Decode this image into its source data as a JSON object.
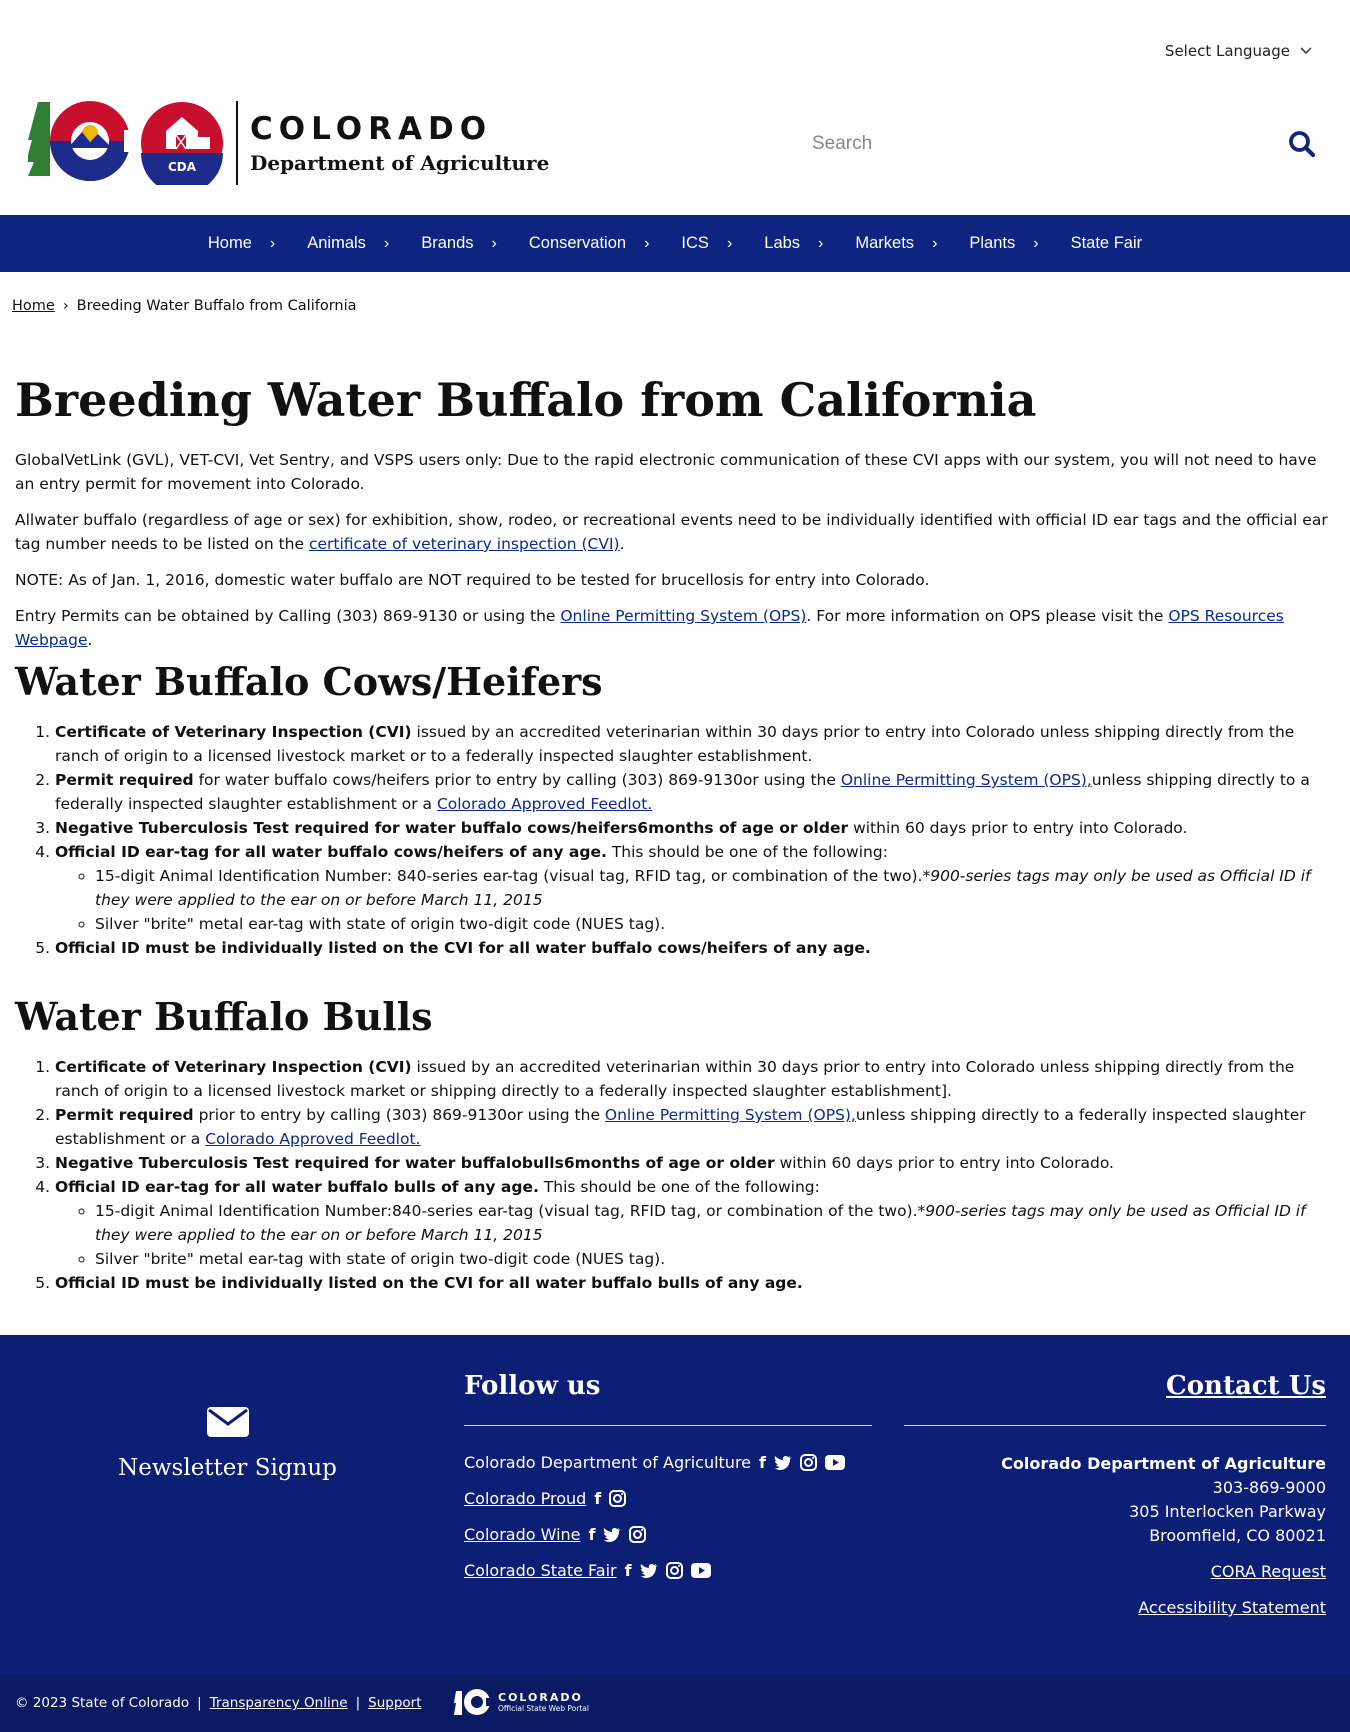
{
  "header": {
    "language_label": "Select Language",
    "logo_title": "COLORADO",
    "logo_subtitle": "Department of Agriculture",
    "logo_badge": "CDA",
    "search_placeholder": "Search"
  },
  "nav": {
    "items": [
      {
        "label": "Home"
      },
      {
        "label": "Animals"
      },
      {
        "label": "Brands"
      },
      {
        "label": "Conservation"
      },
      {
        "label": "ICS"
      },
      {
        "label": "Labs"
      },
      {
        "label": "Markets"
      },
      {
        "label": "Plants"
      },
      {
        "label": "State Fair"
      }
    ]
  },
  "breadcrumb": {
    "home": "Home",
    "separator": "›",
    "current": "Breeding Water Buffalo from California"
  },
  "page": {
    "title": "Breeding Water Buffalo from California",
    "p1": "GlobalVetLink (GVL), VET-CVI, Vet Sentry, and VSPS users only: Due to the rapid electronic communication of these CVI apps with our system, you will not need to have an entry permit for movement into Colorado.",
    "p2_text": "Allwater buffalo (regardless of age or sex) for exhibition, show, rodeo, or recreational events need to be individually identified with official ID ear tags and the official ear tag number needs to be listed on the ",
    "p2_link": "certificate of veterinary inspection (CVI)",
    "p2_end": ".",
    "p3": "NOTE: As of Jan. 1, 2016, domestic water buffalo are NOT required to be tested for brucellosis for entry into Colorado.",
    "p4_text": "Entry Permits can be obtained by Calling (303) 869-9130 or using the ",
    "p4_link1": "Online Permitting System (OPS)",
    "p4_mid": ". For more information on OPS please visit the ",
    "p4_link2": "OPS Resources Webpage",
    "p4_end": "."
  },
  "section_cows": {
    "heading": "Water Buffalo Cows/Heifers",
    "i1_bold": "Certificate of Veterinary Inspection (CVI)",
    "i1_text": " issued by an accredited veterinarian within 30 days prior to entry into Colorado unless shipping directly from the ranch of origin to a licensed livestock market or to a federally inspected slaughter establishment.",
    "i2_bold": "Permit required",
    "i2_text": " for water buffalo cows/heifers prior to entry by calling (303) 869-9130or using the ",
    "i2_link": "Online Permitting System (OPS),",
    "i2_text2": "unless shipping directly to a federally inspected slaughter establishment or a ",
    "i2_link2": "Colorado Approved Feedlot.",
    "i3_bold": "Negative Tuberculosis Test required for water buffalo cows/heifers6months of age or older",
    "i3_text": " within 60 days prior to entry into Colorado.",
    "i4_bold": "Official ID ear-tag for all water buffalo cows/heifers of any age.",
    "i4_text": " This should be one of the following:",
    "i4_sub1_text": "15-digit Animal Identification Number: 840-series ear-tag (visual tag, RFID tag, or combination of the two).",
    "i4_sub1_italic": "*900-series tags may only be used as Official ID if they were applied to the ear on or before March 11, 2015",
    "i4_sub2": "Silver \"brite\" metal ear-tag with state of origin two-digit code (NUES tag).",
    "i5_bold": "Official ID must be individually listed on the CVI for all water buffalo cows/heifers of any age."
  },
  "section_bulls": {
    "heading": "Water Buffalo Bulls",
    "i1_bold": "Certificate of Veterinary Inspection (CVI)",
    "i1_text": " issued by an accredited veterinarian within 30 days prior to entry into Colorado unless shipping directly from the ranch of origin to a licensed livestock market or shipping directly to a federally inspected slaughter establishment].",
    "i2_bold": "Permit required",
    "i2_text": " prior to entry by calling (303) 869-9130or using the ",
    "i2_link": "Online Permitting System (OPS),",
    "i2_text2": "unless shipping directly to a federally inspected slaughter establishment or a ",
    "i2_link2": "Colorado Approved Feedlot.",
    "i3_bold": "Negative Tuberculosis Test required for water buffalobulls6months of age or older",
    "i3_text": " within 60 days prior to entry into Colorado.",
    "i4_bold": "Official ID ear-tag for all water buffalo bulls of any age.",
    "i4_text": " This should be one of the following:",
    "i4_sub1_text": "15-digit Animal Identification Number:840-series ear-tag (visual tag, RFID tag, or combination of the two).",
    "i4_sub1_italic": "*900-series tags may only be used as Official ID if they were applied to the ear on or before March 11, 2015",
    "i4_sub2": "Silver \"brite\" metal ear-tag with state of origin two-digit code (NUES tag).",
    "i5_bold": "Official ID must be individually listed on the CVI for all water buffalo bulls of any age."
  },
  "footer": {
    "newsletter_label": "Newsletter Signup",
    "follow_heading": "Follow us",
    "follow_rows": [
      {
        "label": "Colorado Department of Agriculture",
        "icons": [
          "facebook-icon",
          "twitter-icon",
          "instagram-icon",
          "youtube-icon"
        ]
      },
      {
        "label": "Colorado Proud",
        "icons": [
          "facebook-icon",
          "instagram-icon"
        ]
      },
      {
        "label": "Colorado Wine",
        "icons": [
          "facebook-icon",
          "twitter-icon",
          "instagram-icon"
        ]
      },
      {
        "label": "Colorado State Fair",
        "icons": [
          "facebook-icon",
          "twitter-icon",
          "instagram-icon",
          "youtube-icon"
        ]
      }
    ],
    "contact_heading": "Contact Us",
    "org": "Colorado Department of Agriculture",
    "phone": "303-869-9000",
    "street": "305 Interlocken Parkway",
    "city": "Broomfield, CO 80021",
    "cora": "CORA Request",
    "accessibility": "Accessibility Statement"
  },
  "subfooter": {
    "copyright": "© 2023 State of Colorado",
    "sep": "|",
    "transparency": "Transparency Online",
    "support": "Support",
    "portal_title": "COLORADO",
    "portal_sub": "Official State Web Portal"
  },
  "colors": {
    "nav_bg": "#0d2580",
    "footer_bg": "#0c1f75",
    "link": "#0b2a8a",
    "logo_red": "#c8102e",
    "logo_navy": "#1d2b8a",
    "logo_green": "#2e7d32",
    "logo_gold": "#f2b705"
  }
}
